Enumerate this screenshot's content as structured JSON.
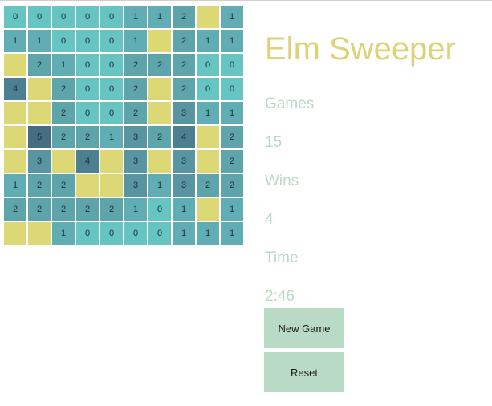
{
  "title": "Elm Sweeper",
  "stats": {
    "games_label": "Games",
    "games_value": "15",
    "wins_label": "Wins",
    "wins_value": "4",
    "time_label": "Time",
    "time_value": "2:46"
  },
  "buttons": {
    "new_game": "New Game",
    "reset": "Reset"
  },
  "colors": {
    "covered": "#dcd876",
    "count_0": "#66c4c3",
    "count_1": "#60aeb3",
    "count_2": "#5ea4ab",
    "count_3": "#5895a0",
    "count_4": "#4c7f90",
    "count_5": "#466d82"
  },
  "board": [
    [
      "0",
      "0",
      "0",
      "0",
      "0",
      "1",
      "1",
      "2",
      "",
      "1"
    ],
    [
      "1",
      "1",
      "0",
      "0",
      "0",
      "1",
      "",
      "2",
      "1",
      "1"
    ],
    [
      "",
      "2",
      "1",
      "0",
      "0",
      "2",
      "2",
      "2",
      "0",
      "0"
    ],
    [
      "4",
      "",
      "2",
      "0",
      "0",
      "2",
      "",
      "2",
      "0",
      "0"
    ],
    [
      "",
      "",
      "2",
      "0",
      "0",
      "2",
      "",
      "3",
      "1",
      "1"
    ],
    [
      "",
      "5",
      "2",
      "2",
      "1",
      "3",
      "2",
      "4",
      "",
      "2"
    ],
    [
      "",
      "3",
      "",
      "4",
      "",
      "3",
      "",
      "3",
      "",
      "2"
    ],
    [
      "1",
      "2",
      "2",
      "",
      "",
      "3",
      "1",
      "3",
      "2",
      "2"
    ],
    [
      "2",
      "2",
      "2",
      "2",
      "2",
      "1",
      "0",
      "1",
      "",
      "1"
    ],
    [
      "",
      "",
      "1",
      "0",
      "0",
      "0",
      "0",
      "1",
      "1",
      "1"
    ]
  ]
}
